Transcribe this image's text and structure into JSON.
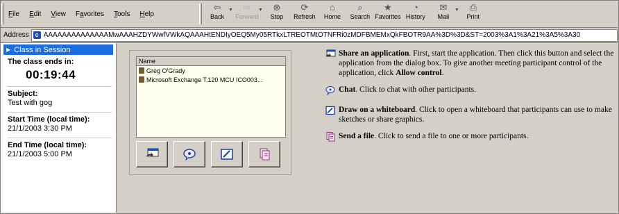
{
  "menu": [
    "File",
    "Edit",
    "View",
    "Favorites",
    "Tools",
    "Help"
  ],
  "menu_underline": [
    "F",
    "E",
    "V",
    "a",
    "T",
    "H"
  ],
  "toolbar": [
    {
      "label": "Back",
      "icon": "back-arrow-icon",
      "glyph": "⇦",
      "dropdown": true,
      "enabled": true
    },
    {
      "label": "Forward",
      "icon": "forward-arrow-icon",
      "glyph": "⇨",
      "dropdown": true,
      "enabled": false
    },
    {
      "label": "Stop",
      "icon": "stop-icon",
      "glyph": "⊗",
      "enabled": true
    },
    {
      "label": "Refresh",
      "icon": "refresh-icon",
      "glyph": "⟳",
      "enabled": true
    },
    {
      "label": "Home",
      "icon": "home-icon",
      "glyph": "⌂",
      "enabled": true
    },
    {
      "label": "Search",
      "icon": "search-icon",
      "glyph": "⌕",
      "enabled": true
    },
    {
      "label": "Favorites",
      "icon": "favorites-icon",
      "glyph": "★",
      "enabled": true
    },
    {
      "label": "History",
      "icon": "history-icon",
      "glyph": "◔",
      "enabled": true
    },
    {
      "label": "Mail",
      "icon": "mail-icon",
      "glyph": "✉",
      "dropdown": true,
      "enabled": true
    },
    {
      "label": "Print",
      "icon": "print-icon",
      "glyph": "⎙",
      "enabled": true
    }
  ],
  "address": {
    "label": "Address",
    "value": "AAAAAAAAAAAAAAMwAAAHZDYWwfVWkAQAAAHtENDIyOEQ5My05RTkxLTREOTMtOTNFRi0zMDFBMEMxQkFBOTR9AA%3D%3D&ST=2003%3A1%3A21%3A5%3A30"
  },
  "session": {
    "header": "Class in Session",
    "ends_label": "The class ends in:",
    "countdown": "00:19:44",
    "subject_label": "Subject:",
    "subject": "Test with gog",
    "start_label": "Start Time (local time):",
    "start": "21/1/2003 3:30 PM",
    "end_label": "End Time (local time):",
    "end": "21/1/2003 5:00 PM"
  },
  "participants": {
    "header": "Name",
    "rows": [
      "Greg O'Grady",
      "Microsoft Exchange T.120 MCU ICO003..."
    ]
  },
  "help": {
    "share_title": "Share an application",
    "share_text": ". First, start the application. Then click this button and select the application from the dialog box. To give another meeting participant control of the application, click ",
    "share_bold": "Allow control",
    "share_end": ".",
    "chat_title": "Chat",
    "chat_text": ". Click to chat with other participants.",
    "draw_title": "Draw on a whiteboard",
    "draw_text": ". Click to open a whiteboard that participants can use to make sketches or share graphics.",
    "send_title": "Send a file",
    "send_text": ". Click to send a file to one or more participants."
  },
  "colors": {
    "accent": "#1c6ee0",
    "chrome": "#d4d0c8"
  }
}
